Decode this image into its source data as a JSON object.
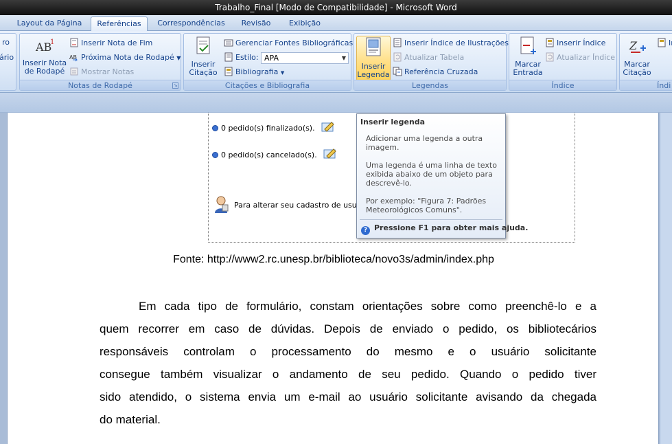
{
  "window": {
    "title": "Trabalho_Final [Modo de Compatibilidade] - Microsoft Word"
  },
  "tabs": [
    {
      "label": "Layout da Página",
      "active": false
    },
    {
      "label": "Referências",
      "active": true
    },
    {
      "label": "Correspondências",
      "active": false
    },
    {
      "label": "Revisão",
      "active": false
    },
    {
      "label": "Exibição",
      "active": false
    }
  ],
  "ribbon": {
    "partial_left": {
      "line1": "ro",
      "line2": "ário"
    },
    "footnotes": {
      "label": "Notas de Rodapé",
      "insert_footnote": "Inserir Nota de Rodapé",
      "insert_footnote_l1": "Inserir Nota",
      "insert_footnote_l2": "de Rodapé",
      "insert_endnote": "Inserir Nota de Fim",
      "next_footnote": "Próxima Nota de Rodapé",
      "show_notes": "Mostrar Notas"
    },
    "citations": {
      "label": "Citações e Bibliografia",
      "insert_citation_l1": "Inserir",
      "insert_citation_l2": "Citação",
      "manage_sources": "Gerenciar Fontes Bibliográficas",
      "style_label": "Estilo:",
      "style_value": "APA",
      "bibliography": "Bibliografia"
    },
    "captions": {
      "label": "Legendas",
      "insert_caption_l1": "Inserir",
      "insert_caption_l2": "Legenda",
      "insert_table_of_figures": "Inserir Índice de Ilustrações",
      "update_table": "Atualizar Tabela",
      "cross_reference": "Referência Cruzada"
    },
    "index": {
      "label": "Índice",
      "mark_entry_l1": "Marcar",
      "mark_entry_l2": "Entrada",
      "insert_index": "Inserir Índice",
      "update_index": "Atualizar Índice"
    },
    "partial_right": {
      "mark_citation_l1": "Marcar",
      "mark_citation_l2": "Citação",
      "label": "Índi",
      "small1": "In"
    }
  },
  "document": {
    "figure": {
      "line1": "0 pedido(s) finalizado(s).",
      "line2": "0 pedido(s) cancelado(s).",
      "line3": "Para alterar seu cadastro de usu"
    },
    "caption": "Fonte: http://www2.rc.unesp.br/biblioteca/novo3s/admin/index.php",
    "paragraph_lines": [
      "Em cada tipo de formulário, constam orientações sobre como preenchê-lo e a",
      "quem recorrer em caso de dúvidas. Depois de enviado o pedido, os bibliotecários",
      "responsáveis controlam o processamento do mesmo e o usuário solicitante",
      "consegue também visualizar o andamento de seu pedido. Quando o pedido tiver",
      "sido atendido, o sistema envia um e-mail ao usuário solicitante avisando da chegada",
      "do material."
    ]
  },
  "tooltip": {
    "title": "Inserir legenda",
    "p1": "Adicionar uma legenda a outra imagem.",
    "p2": "Uma legenda é uma linha de texto exibida abaixo de um objeto para descrevê-lo.",
    "p3": "Por exemplo: \"Figura 7: Padrões Meteorológicos Comuns\".",
    "help": "Pressione F1 para obter mais ajuda."
  },
  "icons": {
    "footnote": "footnote-icon",
    "endnote": "endnote-icon",
    "next_footnote": "next-footnote-icon",
    "citation": "citation-icon",
    "caption": "caption-icon",
    "mark_entry": "mark-entry-icon",
    "help": "help-icon"
  },
  "colors": {
    "ribbon_text": "#15428b",
    "highlight": "#ffd35a",
    "titlebar": "#101010"
  }
}
